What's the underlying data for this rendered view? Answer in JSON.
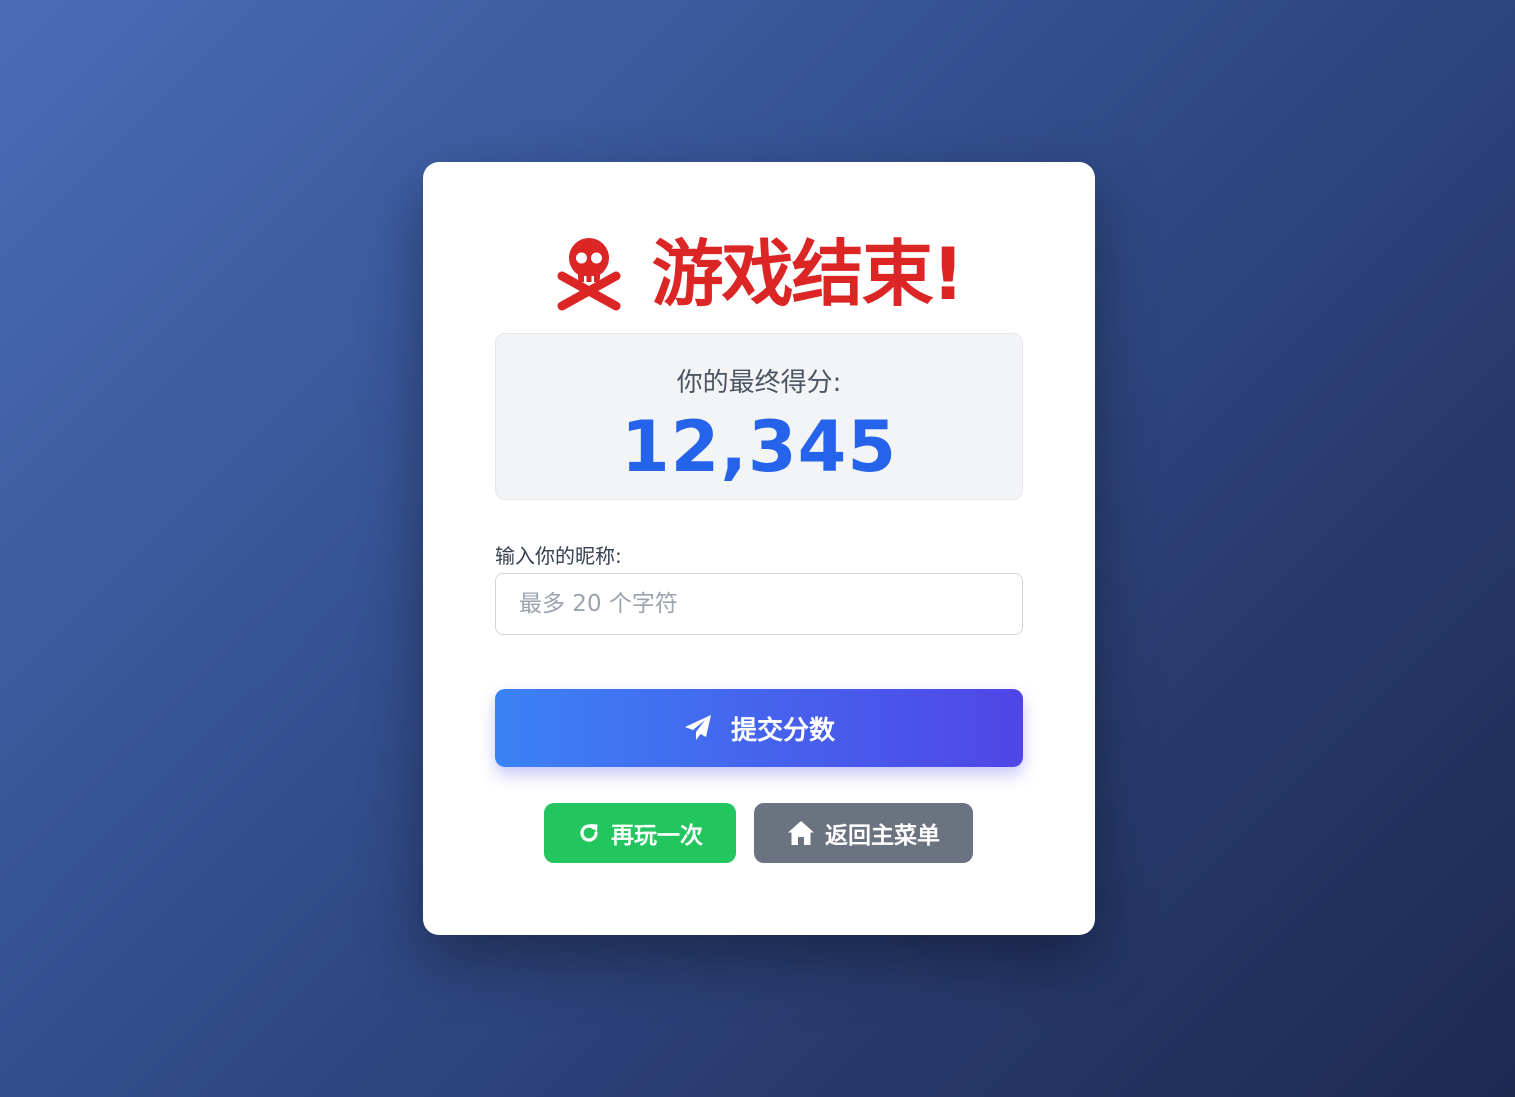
{
  "title": "游戏结束!",
  "icons": {
    "title_icon": "skull-crossbones-icon",
    "submit_icon": "paper-plane-icon",
    "replay_icon": "redo-icon",
    "home_icon": "home-icon"
  },
  "score": {
    "label": "你的最终得分:",
    "value": "12,345"
  },
  "nickname": {
    "label": "输入你的昵称:",
    "placeholder": "最多 20 个字符",
    "value": ""
  },
  "buttons": {
    "submit": "提交分数",
    "replay": "再玩一次",
    "main_menu": "返回主菜单"
  },
  "colors": {
    "title": "#dc2626",
    "score": "#2563eb",
    "submit_gradient_start": "#3b82f6",
    "submit_gradient_end": "#4f46e5",
    "replay": "#22c55e",
    "main_menu": "#6b7280"
  }
}
